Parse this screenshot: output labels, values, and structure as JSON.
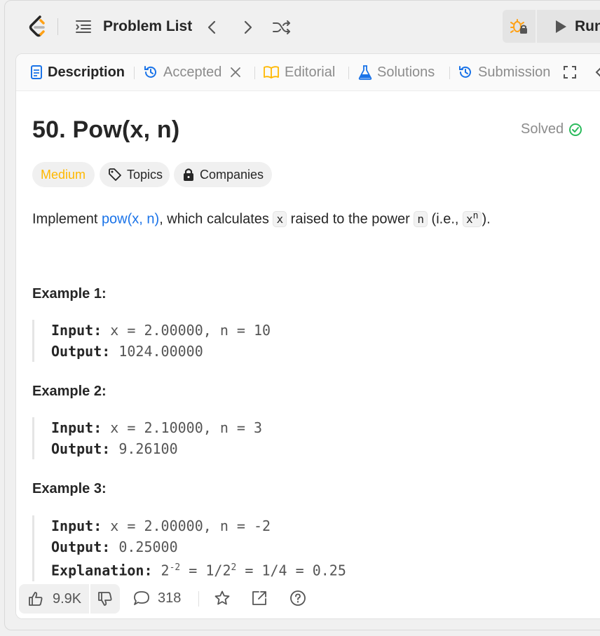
{
  "topbar": {
    "problem_list_label": "Problem List",
    "run_label": "Run"
  },
  "tabs": [
    {
      "label": "Description",
      "icon": "document-icon",
      "active": true
    },
    {
      "label": "Accepted",
      "icon": "history-icon",
      "closable": true
    },
    {
      "label": "Editorial",
      "icon": "book-icon"
    },
    {
      "label": "Solutions",
      "icon": "flask-icon"
    },
    {
      "label": "Submission",
      "icon": "history-icon"
    }
  ],
  "problem": {
    "title": "50. Pow(x, n)",
    "status": "Solved",
    "difficulty": "Medium",
    "topics_label": "Topics",
    "companies_label": "Companies",
    "desc_prefix": "Implement ",
    "desc_link": "pow(x, n)",
    "desc_mid": ", which calculates ",
    "desc_code_x": "x",
    "desc_mid2": " raised to the power ",
    "desc_code_n": "n",
    "desc_mid3": " (i.e., ",
    "desc_code_xn_base": "x",
    "desc_code_xn_exp": "n",
    "desc_suffix": ")."
  },
  "examples": [
    {
      "title": "Example 1:",
      "input_label": "Input:",
      "input": " x = 2.00000, n = 10",
      "output_label": "Output:",
      "output": " 1024.00000"
    },
    {
      "title": "Example 2:",
      "input_label": "Input:",
      "input": " x = 2.10000, n = 3",
      "output_label": "Output:",
      "output": " 9.26100"
    },
    {
      "title": "Example 3:",
      "input_label": "Input:",
      "input": " x = 2.00000, n = -2",
      "output_label": "Output:",
      "output": " 0.25000",
      "explanation_label": "Explanation:",
      "exp_a": " 2",
      "exp_a_sup": "-2",
      "exp_b": " = 1/2",
      "exp_b_sup": "2",
      "exp_c": " = 1/4 = 0.25"
    }
  ],
  "footer": {
    "likes": "9.9K",
    "comments": "318"
  },
  "colors": {
    "medium": "#ffb800",
    "solved_check": "#2cbb5d",
    "link": "#1a73e8"
  }
}
